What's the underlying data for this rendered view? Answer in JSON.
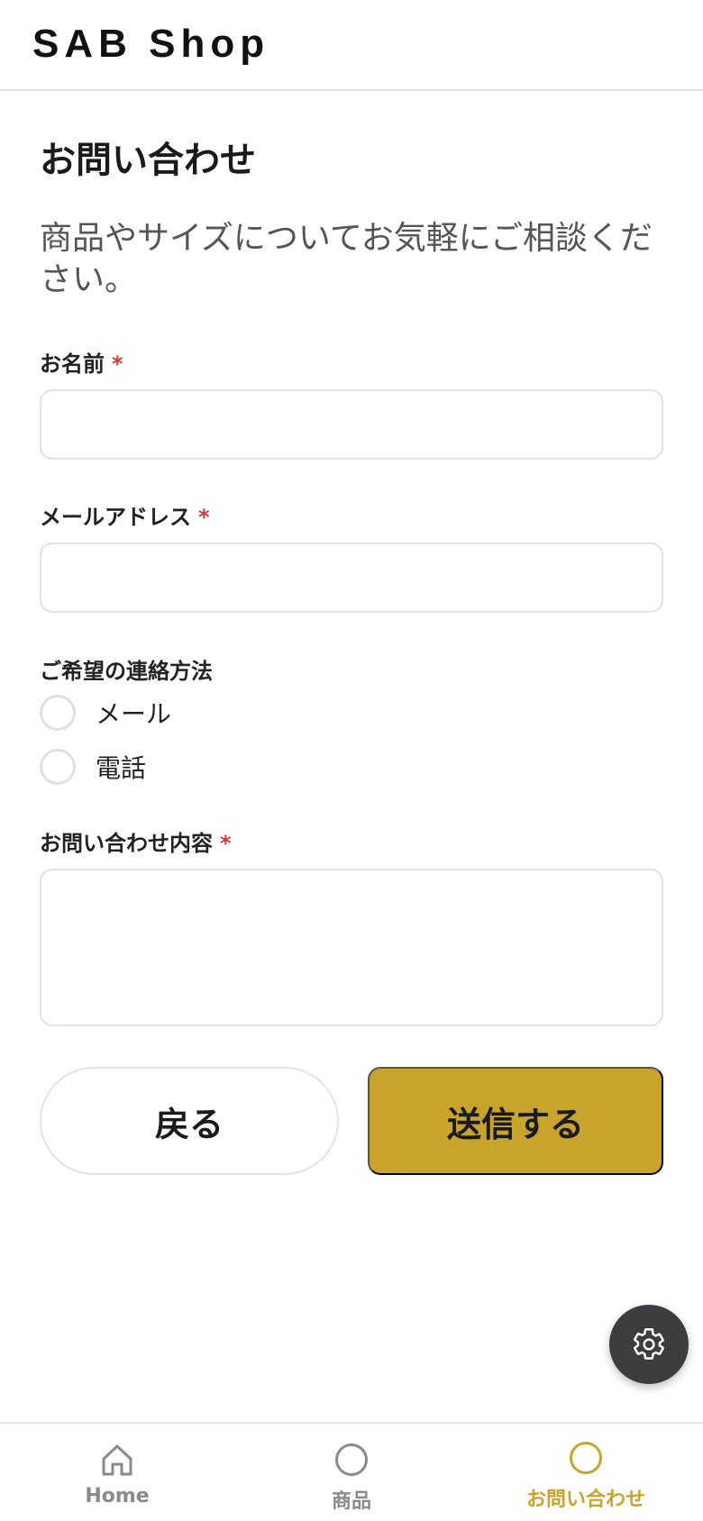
{
  "header": {
    "brand": "SAB Shop"
  },
  "main": {
    "title": "お問い合わせ",
    "description": "商品やサイズについてお気軽にご相談ください。",
    "required_mark": "*",
    "fields": {
      "name": {
        "label": "お名前",
        "value": ""
      },
      "email": {
        "label": "メールアドレス",
        "value": ""
      },
      "contact_method": {
        "label": "ご希望の連絡方法",
        "options": [
          {
            "label": "メール",
            "selected": false
          },
          {
            "label": "電話",
            "selected": false
          }
        ]
      },
      "message": {
        "label": "お問い合わせ内容",
        "value": ""
      }
    },
    "buttons": {
      "back": "戻る",
      "submit": "送信する"
    }
  },
  "fab": {
    "icon": "gear-icon"
  },
  "bottom_nav": {
    "items": [
      {
        "label": "Home",
        "icon": "home-icon",
        "active": false
      },
      {
        "label": "商品",
        "icon": "circle-icon",
        "active": false
      },
      {
        "label": "お問い合わせ",
        "icon": "circle-icon",
        "active": true
      }
    ]
  },
  "colors": {
    "accent": "#c9a42a",
    "required": "#d23a3a",
    "fab_bg": "#3d3d3f",
    "nav_inactive": "#8a8a8a",
    "border": "#e2e2e2"
  }
}
